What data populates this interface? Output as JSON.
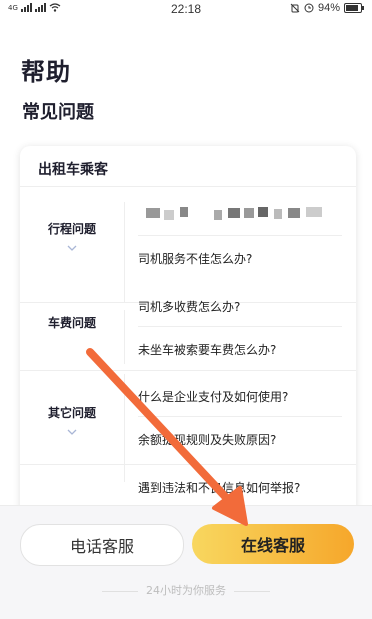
{
  "status_bar": {
    "network_label": "4G",
    "time": "22:18",
    "battery_percent": "94%"
  },
  "page": {
    "title": "帮助",
    "section_title": "常见问题"
  },
  "faq": {
    "group_title": "出租车乘客",
    "categories": [
      {
        "name": "行程问题",
        "questions": [
          "",
          "司机服务不佳怎么办?"
        ]
      },
      {
        "name": "车费问题",
        "questions": [
          "司机多收费怎么办?",
          "未坐车被索要车费怎么办?"
        ]
      },
      {
        "name": "其它问题",
        "questions": [
          "什么是企业支付及如何使用?",
          "余额提现规则及失败原因?",
          "遇到违法和不良信息如何举报?"
        ]
      }
    ]
  },
  "bottom": {
    "phone_label": "电话客服",
    "online_label": "在线客服",
    "footer_note": "24小时为你服务"
  },
  "colors": {
    "accent_gradient_start": "#f8d75f",
    "accent_gradient_end": "#f6a72b",
    "annotation_arrow": "#f26b3a"
  }
}
